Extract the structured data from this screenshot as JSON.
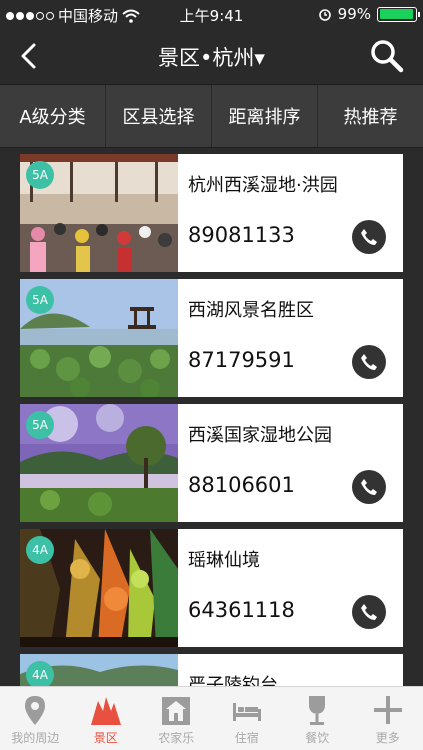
{
  "status_bar": {
    "carrier": "中国移动",
    "time": "上午9:41",
    "battery": "99%"
  },
  "nav": {
    "title": "景区•杭州▾"
  },
  "filters": [
    {
      "label": "A级分类"
    },
    {
      "label": "区县选择"
    },
    {
      "label": "距离排序"
    },
    {
      "label": "热推荐"
    }
  ],
  "items": [
    {
      "badge": "5A",
      "name": "杭州西溪湿地·洪园",
      "phone": "89081133"
    },
    {
      "badge": "5A",
      "name": "西湖风景名胜区",
      "phone": "87179591"
    },
    {
      "badge": "5A",
      "name": "西溪国家湿地公园",
      "phone": "88106601"
    },
    {
      "badge": "4A",
      "name": "瑶琳仙境",
      "phone": "64361118"
    },
    {
      "badge": "4A",
      "name": "严子陵钓台",
      "phone": ""
    }
  ],
  "tabs": [
    {
      "label": "我的周边"
    },
    {
      "label": "景区"
    },
    {
      "label": "农家乐"
    },
    {
      "label": "住宿"
    },
    {
      "label": "餐饮"
    },
    {
      "label": "更多"
    }
  ],
  "colors": {
    "badge": "#3cc1a6",
    "active_tab": "#e8503f",
    "battery": "#19d15b"
  }
}
